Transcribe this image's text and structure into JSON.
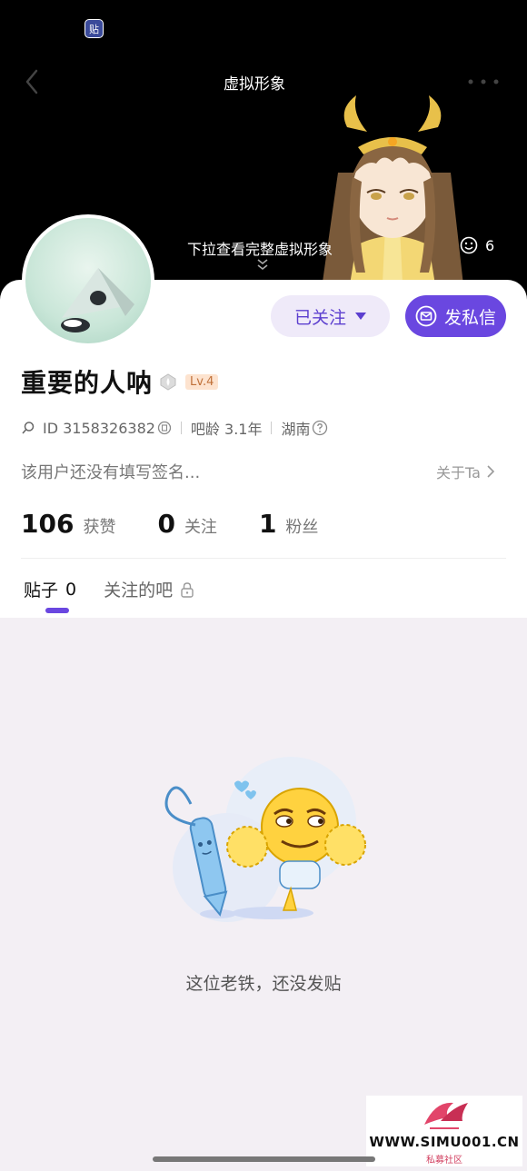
{
  "header": {
    "status_app_icon": "贴",
    "title": "虚拟形象",
    "pull_hint": "下拉查看完整虚拟形象",
    "avatar_count": "6",
    "icons": [
      "back-icon",
      "more-icon",
      "chevron-down-icon",
      "smile-icon"
    ]
  },
  "profile": {
    "follow_label": "已关注",
    "dm_label": "发私信",
    "username": "重要的人呐",
    "level": "Lv.4",
    "id_text": "ID 3158326382",
    "bar_age": "吧龄 3.1年",
    "location": "湖南",
    "bio": "该用户还没有填写签名...",
    "about_label": "关于Ta"
  },
  "stats": [
    {
      "value": "106",
      "label": "获赞"
    },
    {
      "value": "0",
      "label": "关注"
    },
    {
      "value": "1",
      "label": "粉丝"
    }
  ],
  "tabs": [
    {
      "label": "贴子",
      "count": "0"
    },
    {
      "label": "关注的吧"
    }
  ],
  "empty": {
    "message": "这位老铁，还没发贴"
  },
  "watermark": {
    "text": "WWW.SIMU001.CN",
    "sub": "私募社区"
  },
  "colors": {
    "accent": "#6a47e0",
    "follow_bg": "#efeaf9",
    "page_bg": "#f3eff4",
    "level_bg": "#fde3cf"
  }
}
